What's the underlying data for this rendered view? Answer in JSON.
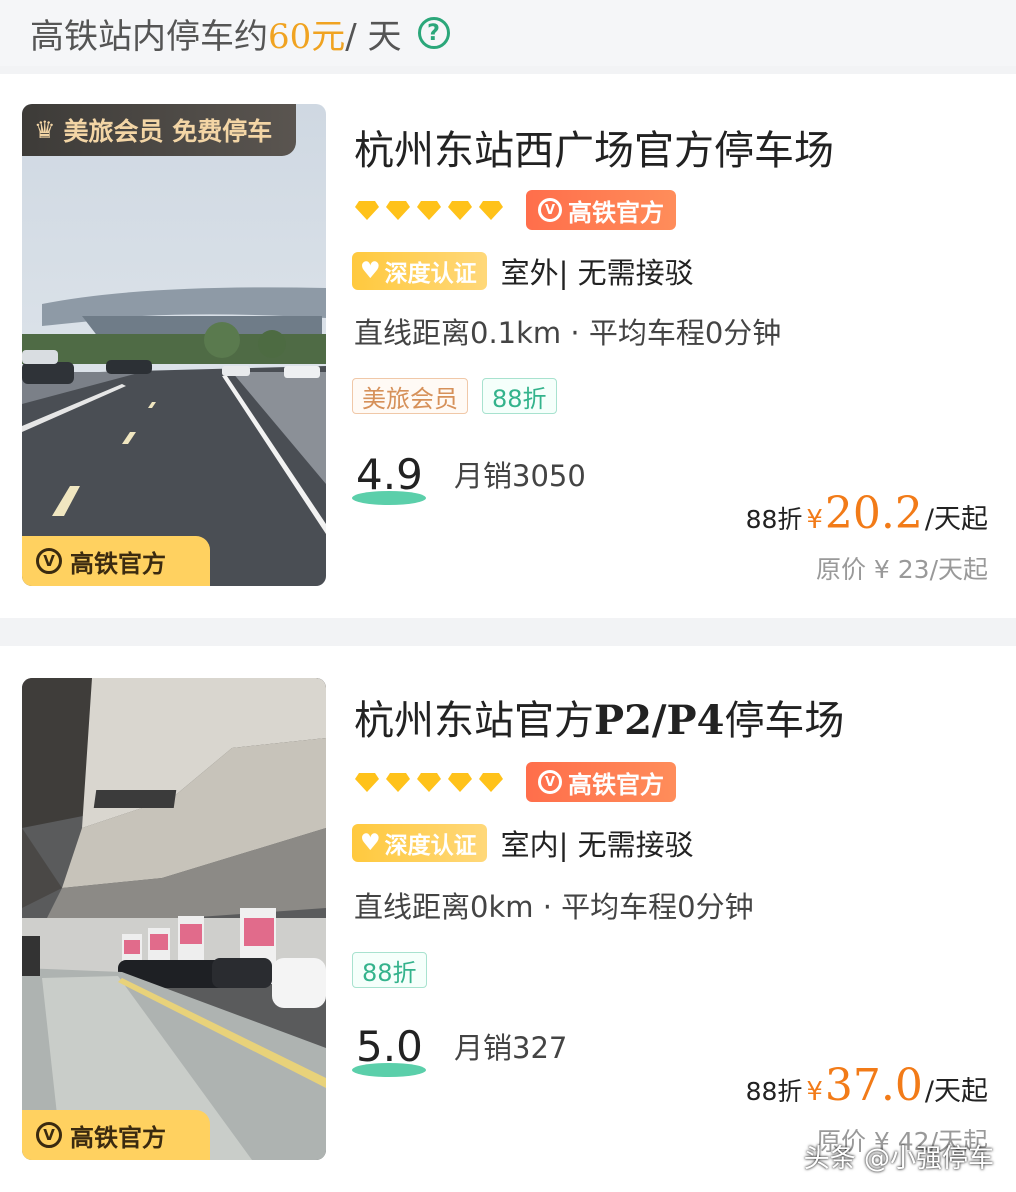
{
  "header": {
    "prefix": "高铁站内停车约",
    "price": "60元",
    "suffix": " / 天",
    "help_icon": "?"
  },
  "listings": [
    {
      "promo_ribbon": "美旅会员 免费停车",
      "photo_badge": "高铁官方",
      "name": "杭州东站西广场官方停车场",
      "name_latin": "",
      "official_tag": "高铁官方",
      "cert_tag": "深度认证",
      "features": "室外| 无需接驳",
      "distance": "直线距离0.1km · 平均车程0分钟",
      "chips": [
        "美旅会员",
        "88折"
      ],
      "score": "4.9",
      "sales": "月销3050",
      "discount_label": "88折",
      "currency": "¥",
      "price": "20.2",
      "price_unit": "/天起",
      "original_price": "原价 ¥ 23/天起"
    },
    {
      "promo_ribbon": "",
      "photo_badge": "高铁官方",
      "name": "杭州东站官方",
      "name_latin": "P2/P4",
      "name_suffix": "停车场",
      "official_tag": "高铁官方",
      "cert_tag": "深度认证",
      "features": "室内| 无需接驳",
      "distance": "直线距离0km · 平均车程0分钟",
      "chips": [
        "88折"
      ],
      "score": "5.0",
      "sales": "月销327",
      "discount_label": "88折",
      "currency": "¥",
      "price": "37.0",
      "price_unit": "/天起",
      "original_price": "原价 ¥ 42/天起"
    }
  ],
  "watermark": "头条 @小强停车",
  "colors": {
    "accent_orange": "#f27b18",
    "official_red": "#ff6e4b",
    "cert_yellow": "#ffc93e",
    "discount_green": "#34b38c",
    "diamond_yellow": "#ffc21a"
  }
}
